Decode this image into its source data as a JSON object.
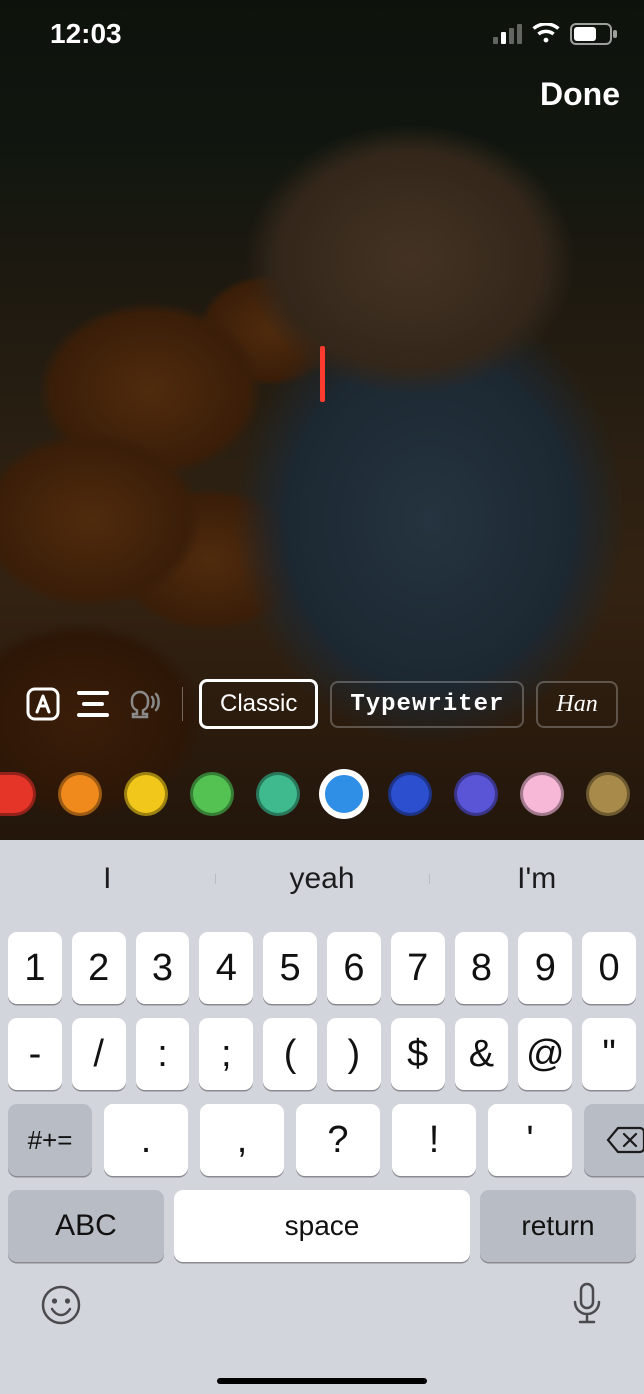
{
  "status": {
    "time": "12:03"
  },
  "header": {
    "done_label": "Done"
  },
  "toolbar": {
    "fonts": [
      {
        "label": "Classic",
        "selected": true
      },
      {
        "label": "Typewriter",
        "selected": false
      },
      {
        "label": "Han",
        "selected": false
      }
    ]
  },
  "colors": {
    "swatches": [
      "#e53528",
      "#f08a1d",
      "#f1c71b",
      "#54c252",
      "#3fb98e",
      "#2f8ee6",
      "#2c4fd0",
      "#5a54d6",
      "#f7b8d8",
      "#a88a4b",
      "#1f6b3a"
    ],
    "selected_index": 5
  },
  "suggestions": [
    "I",
    "yeah",
    "I'm"
  ],
  "keyboard": {
    "row1": [
      "1",
      "2",
      "3",
      "4",
      "5",
      "6",
      "7",
      "8",
      "9",
      "0"
    ],
    "row2": [
      "-",
      "/",
      ":",
      ";",
      "(",
      ")",
      "$",
      "&",
      "@",
      "\""
    ],
    "row3": [
      ".",
      ",",
      "?",
      "!",
      "'"
    ],
    "shift_label": "#+=",
    "abc_label": "ABC",
    "space_label": "space",
    "return_label": "return"
  }
}
